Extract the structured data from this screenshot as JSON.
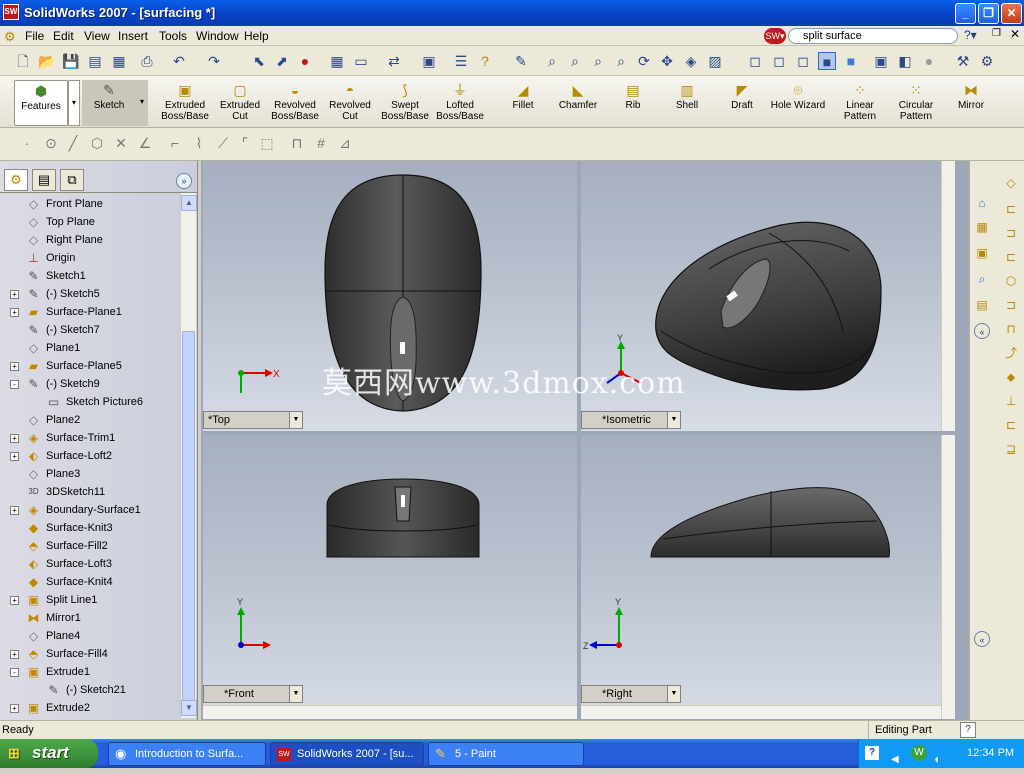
{
  "window": {
    "title": "SolidWorks 2007 - [surfacing *]",
    "app_icon": "SW"
  },
  "menu": [
    "File",
    "Edit",
    "View",
    "Insert",
    "Tools",
    "Window",
    "Help"
  ],
  "search": {
    "value": "split surface"
  },
  "command_manager": {
    "groups": [
      "Features",
      "Sketch"
    ],
    "commands": [
      {
        "label": "Extruded Boss/Base",
        "icon": "extruded-boss-icon"
      },
      {
        "label": "Extruded Cut",
        "icon": "extruded-cut-icon"
      },
      {
        "label": "Revolved Boss/Base",
        "icon": "revolved-boss-icon"
      },
      {
        "label": "Revolved Cut",
        "icon": "revolved-cut-icon"
      },
      {
        "label": "Swept Boss/Base",
        "icon": "swept-boss-icon"
      },
      {
        "label": "Lofted Boss/Base",
        "icon": "lofted-boss-icon"
      },
      {
        "label": "Fillet",
        "icon": "fillet-icon"
      },
      {
        "label": "Chamfer",
        "icon": "chamfer-icon"
      },
      {
        "label": "Rib",
        "icon": "rib-icon"
      },
      {
        "label": "Shell",
        "icon": "shell-icon"
      },
      {
        "label": "Draft",
        "icon": "draft-icon"
      },
      {
        "label": "Hole Wizard",
        "icon": "hole-wizard-icon"
      },
      {
        "label": "Linear Pattern",
        "icon": "linear-pattern-icon"
      },
      {
        "label": "Circular Pattern",
        "icon": "circular-pattern-icon"
      },
      {
        "label": "Mirror",
        "icon": "mirror-icon"
      }
    ]
  },
  "feature_tree": [
    {
      "label": "Front Plane",
      "icon": "plane-icon",
      "expander": ""
    },
    {
      "label": "Top Plane",
      "icon": "plane-icon",
      "expander": ""
    },
    {
      "label": "Right Plane",
      "icon": "plane-icon",
      "expander": ""
    },
    {
      "label": "Origin",
      "icon": "origin-icon",
      "expander": ""
    },
    {
      "label": "Sketch1",
      "icon": "sketch-icon",
      "expander": ""
    },
    {
      "label": "(-) Sketch5",
      "icon": "sketch-icon",
      "expander": "+"
    },
    {
      "label": "Surface-Plane1",
      "icon": "surface-plane-icon",
      "expander": "+"
    },
    {
      "label": "(-) Sketch7",
      "icon": "sketch-icon",
      "expander": ""
    },
    {
      "label": "Plane1",
      "icon": "plane-icon",
      "expander": ""
    },
    {
      "label": "Surface-Plane5",
      "icon": "surface-plane-icon",
      "expander": "+"
    },
    {
      "label": "(-) Sketch9",
      "icon": "sketch-icon",
      "expander": "-"
    },
    {
      "label": "Sketch Picture6",
      "icon": "sketch-picture-icon",
      "expander": "",
      "indent": 1
    },
    {
      "label": "Plane2",
      "icon": "plane-icon",
      "expander": ""
    },
    {
      "label": "Surface-Trim1",
      "icon": "surface-trim-icon",
      "expander": "+"
    },
    {
      "label": "Surface-Loft2",
      "icon": "surface-loft-icon",
      "expander": "+"
    },
    {
      "label": "Plane3",
      "icon": "plane-icon",
      "expander": ""
    },
    {
      "label": "3DSketch11",
      "icon": "3d-sketch-icon",
      "expander": ""
    },
    {
      "label": "Boundary-Surface1",
      "icon": "boundary-surface-icon",
      "expander": "+"
    },
    {
      "label": "Surface-Knit3",
      "icon": "surface-knit-icon",
      "expander": ""
    },
    {
      "label": "Surface-Fill2",
      "icon": "surface-fill-icon",
      "expander": ""
    },
    {
      "label": "Surface-Loft3",
      "icon": "surface-loft-icon",
      "expander": ""
    },
    {
      "label": "Surface-Knit4",
      "icon": "surface-knit-icon",
      "expander": ""
    },
    {
      "label": "Split Line1",
      "icon": "split-line-icon",
      "expander": "+"
    },
    {
      "label": "Mirror1",
      "icon": "mirror-icon",
      "expander": ""
    },
    {
      "label": "Plane4",
      "icon": "plane-icon",
      "expander": ""
    },
    {
      "label": "Surface-Fill4",
      "icon": "surface-fill-icon",
      "expander": "+"
    },
    {
      "label": "Extrude1",
      "icon": "extrude-icon",
      "expander": "-"
    },
    {
      "label": "(-) Sketch21",
      "icon": "sketch-icon",
      "expander": "",
      "indent": 1
    },
    {
      "label": "Extrude2",
      "icon": "extrude-icon",
      "expander": "+"
    }
  ],
  "views": {
    "top": "*Top",
    "isometric": "*Isometric",
    "front": "*Front",
    "right": "*Right"
  },
  "triad": {
    "x": "X",
    "y": "Y",
    "z": "Z"
  },
  "watermark": "莫西网www.3dmox.com",
  "status": {
    "left": "Ready",
    "right": "Editing Part"
  },
  "taskbar": {
    "start": "start",
    "buttons": [
      {
        "label": "Introduction to Surfa...",
        "icon": "browser-icon"
      },
      {
        "label": "SolidWorks 2007 - [su...",
        "icon": "solidworks-icon"
      },
      {
        "label": "5 - Paint",
        "icon": "paint-icon"
      }
    ],
    "clock": "12:34 PM"
  },
  "colors": {
    "titlebar": "#0a4fd8",
    "taskbar": "#245edb",
    "start": "#3c913a",
    "model": "#454545"
  }
}
